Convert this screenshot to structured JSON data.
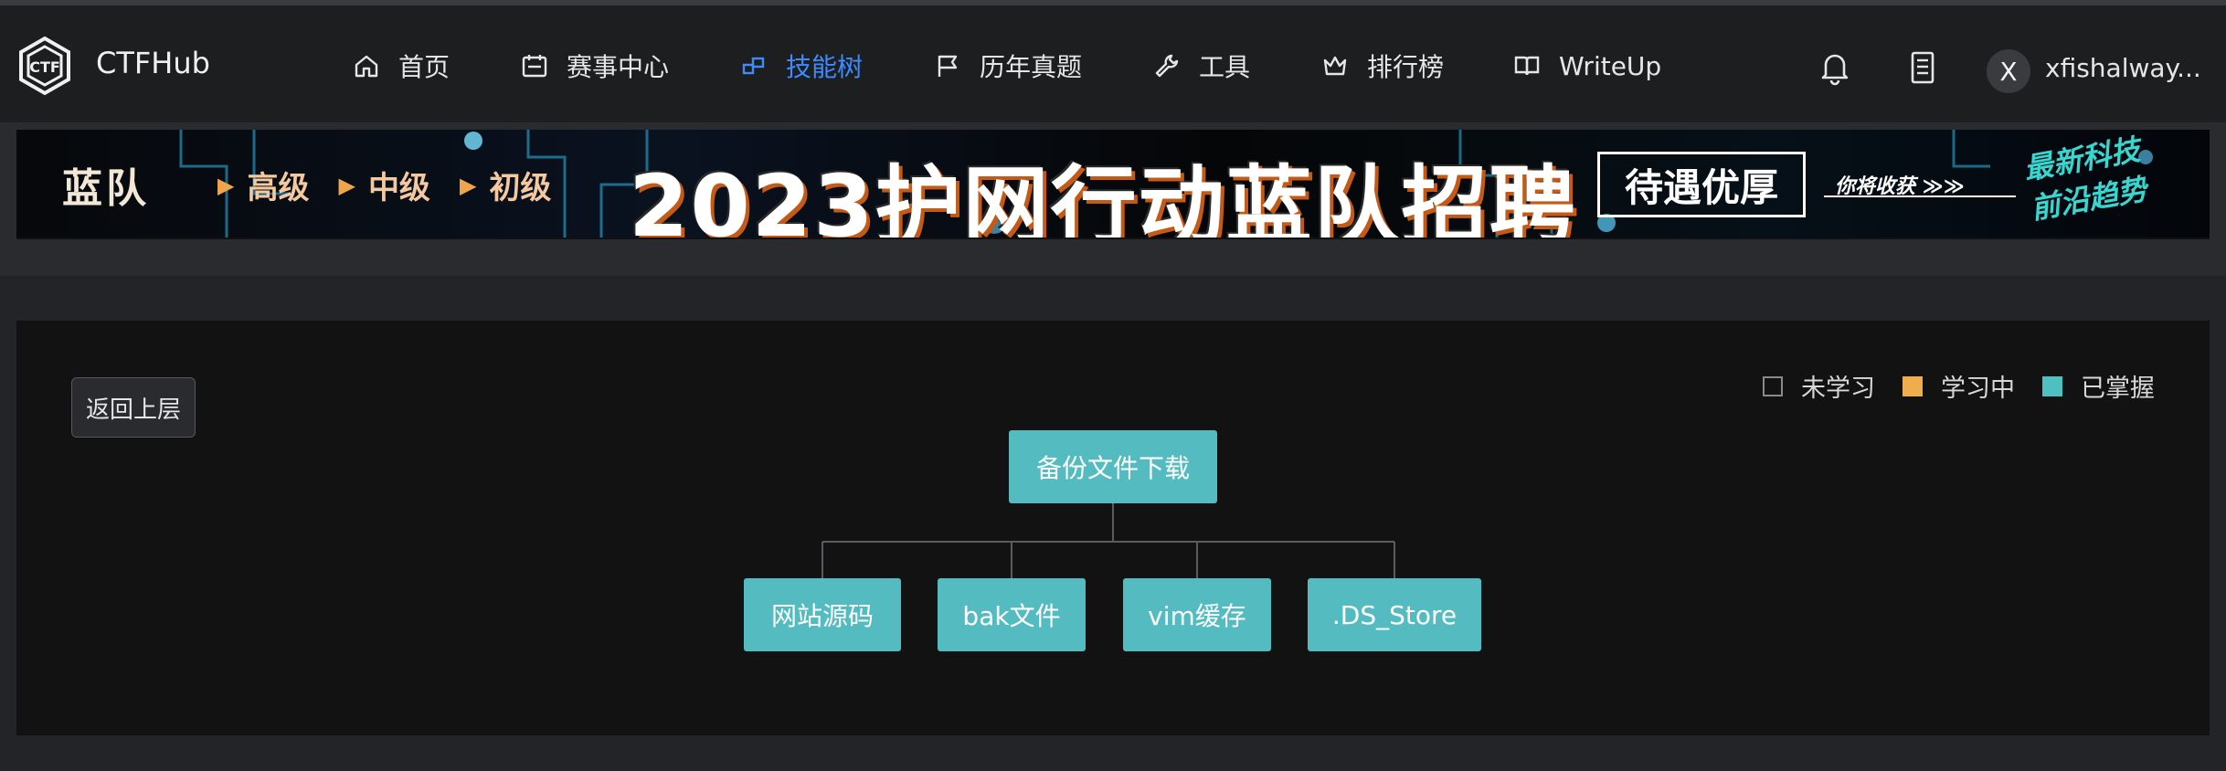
{
  "brand": {
    "name": "CTFHub",
    "logo_icon": "ctfhub-hexagon-logo-icon"
  },
  "nav": {
    "items": [
      {
        "label": "首页",
        "icon": "home-icon"
      },
      {
        "label": "赛事中心",
        "icon": "calendar-icon"
      },
      {
        "label": "技能树",
        "icon": "skill-tree-icon",
        "active": true
      },
      {
        "label": "历年真题",
        "icon": "flag-icon"
      },
      {
        "label": "工具",
        "icon": "wrench-icon"
      },
      {
        "label": "排行榜",
        "icon": "crown-icon"
      },
      {
        "label": "WriteUp",
        "icon": "book-icon"
      }
    ],
    "active_color": "#3d8bff"
  },
  "user": {
    "avatar_letter": "X",
    "username": "xfishalway..."
  },
  "banner": {
    "left_text": "蓝队",
    "levels": [
      "高级",
      "中级",
      "初级"
    ],
    "title": "2023护网行动蓝队招聘",
    "box_text": "待遇优厚",
    "tagline": "你将收获",
    "slogan_line1": "最新科技",
    "slogan_line2": "前沿趋势"
  },
  "content": {
    "back_button": "返回上层",
    "legend": [
      {
        "label": "未学习",
        "color": "#8a8a8a",
        "state": "none"
      },
      {
        "label": "学习中",
        "color": "#f0ad4e",
        "state": "learning"
      },
      {
        "label": "已掌握",
        "color": "#4fbfc2",
        "state": "mastered"
      }
    ],
    "tree": {
      "root": "备份文件下载",
      "children": [
        "网站源码",
        "bak文件",
        "vim缓存",
        ".DS_Store"
      ],
      "node_color": "#54bcc0"
    }
  }
}
